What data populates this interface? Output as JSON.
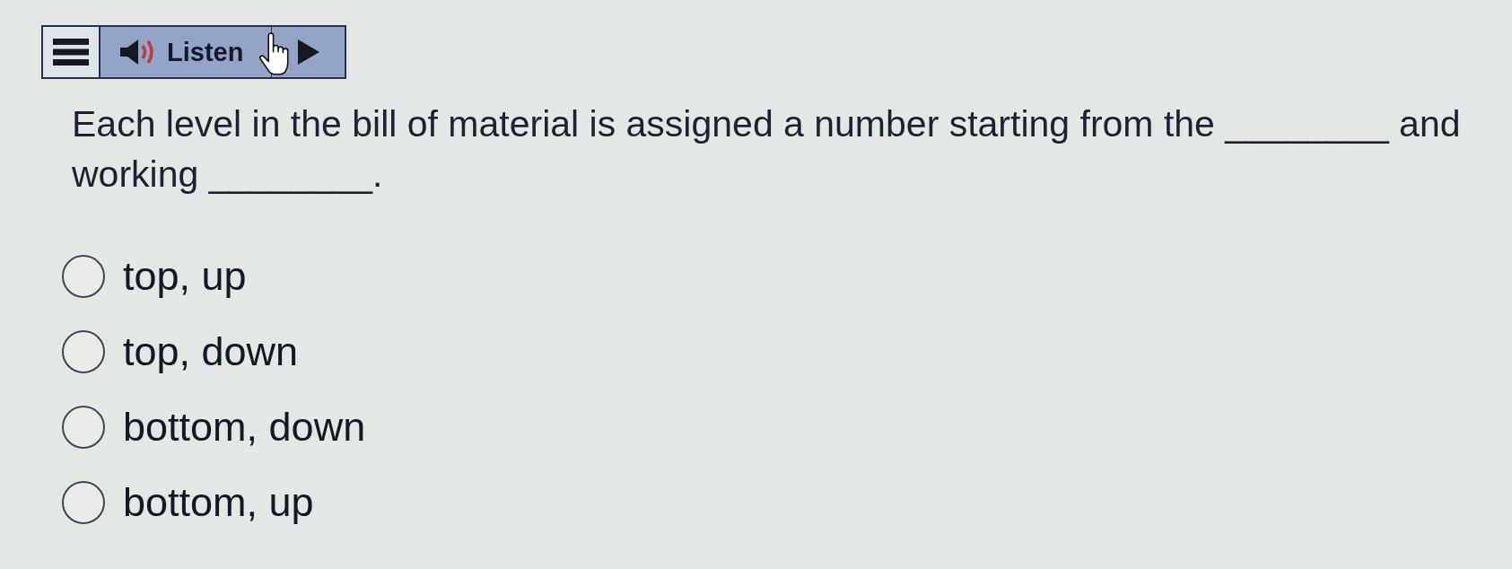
{
  "toolbar": {
    "listen_label": "Listen"
  },
  "question": {
    "text": "Each level in the bill of material is assigned a number starting from the ________ and working ________."
  },
  "options": [
    {
      "label": "top, up",
      "selected": false
    },
    {
      "label": "top, down",
      "selected": false
    },
    {
      "label": "bottom, down",
      "selected": false
    },
    {
      "label": "bottom, up",
      "selected": false
    }
  ]
}
